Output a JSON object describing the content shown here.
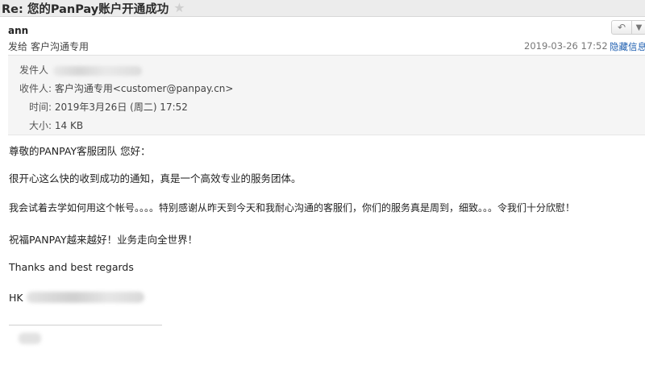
{
  "subject": "Re: 您的PanPay账户开通成功",
  "header": {
    "sender_name": "ann",
    "to_label": "发给",
    "to_name": "客户沟通专用",
    "date": "2019-03-26 17:52",
    "hide_info": "隐藏信息"
  },
  "details": {
    "from_label": "发件人",
    "to_label": "收件人:",
    "to_value": "客户沟通专用<customer@panpay.cn>",
    "time_label": "时间:",
    "time_value": "2019年3月26日 (周二) 17:52",
    "size_label": "大小:",
    "size_value": "14 KB"
  },
  "body": {
    "greeting": "尊敬的PANPAY客服团队 您好：",
    "line1": "很开心这么快的收到成功的通知，真是一个高效专业的服务团体。",
    "line2": "我会试着去学如何用这个帐号。。。。特别感谢从昨天到今天和我耐心沟通的客服们，你们的服务真是周到，细致。。。令我们十分欣慰！",
    "line3": "祝福PANPAY越来越好！业务走向全世界！",
    "closing": "Thanks and best regards",
    "signature_prefix": "HK"
  },
  "icons": {
    "star": "star-icon",
    "reply": "reply-icon",
    "more": "chevron-down-icon"
  }
}
